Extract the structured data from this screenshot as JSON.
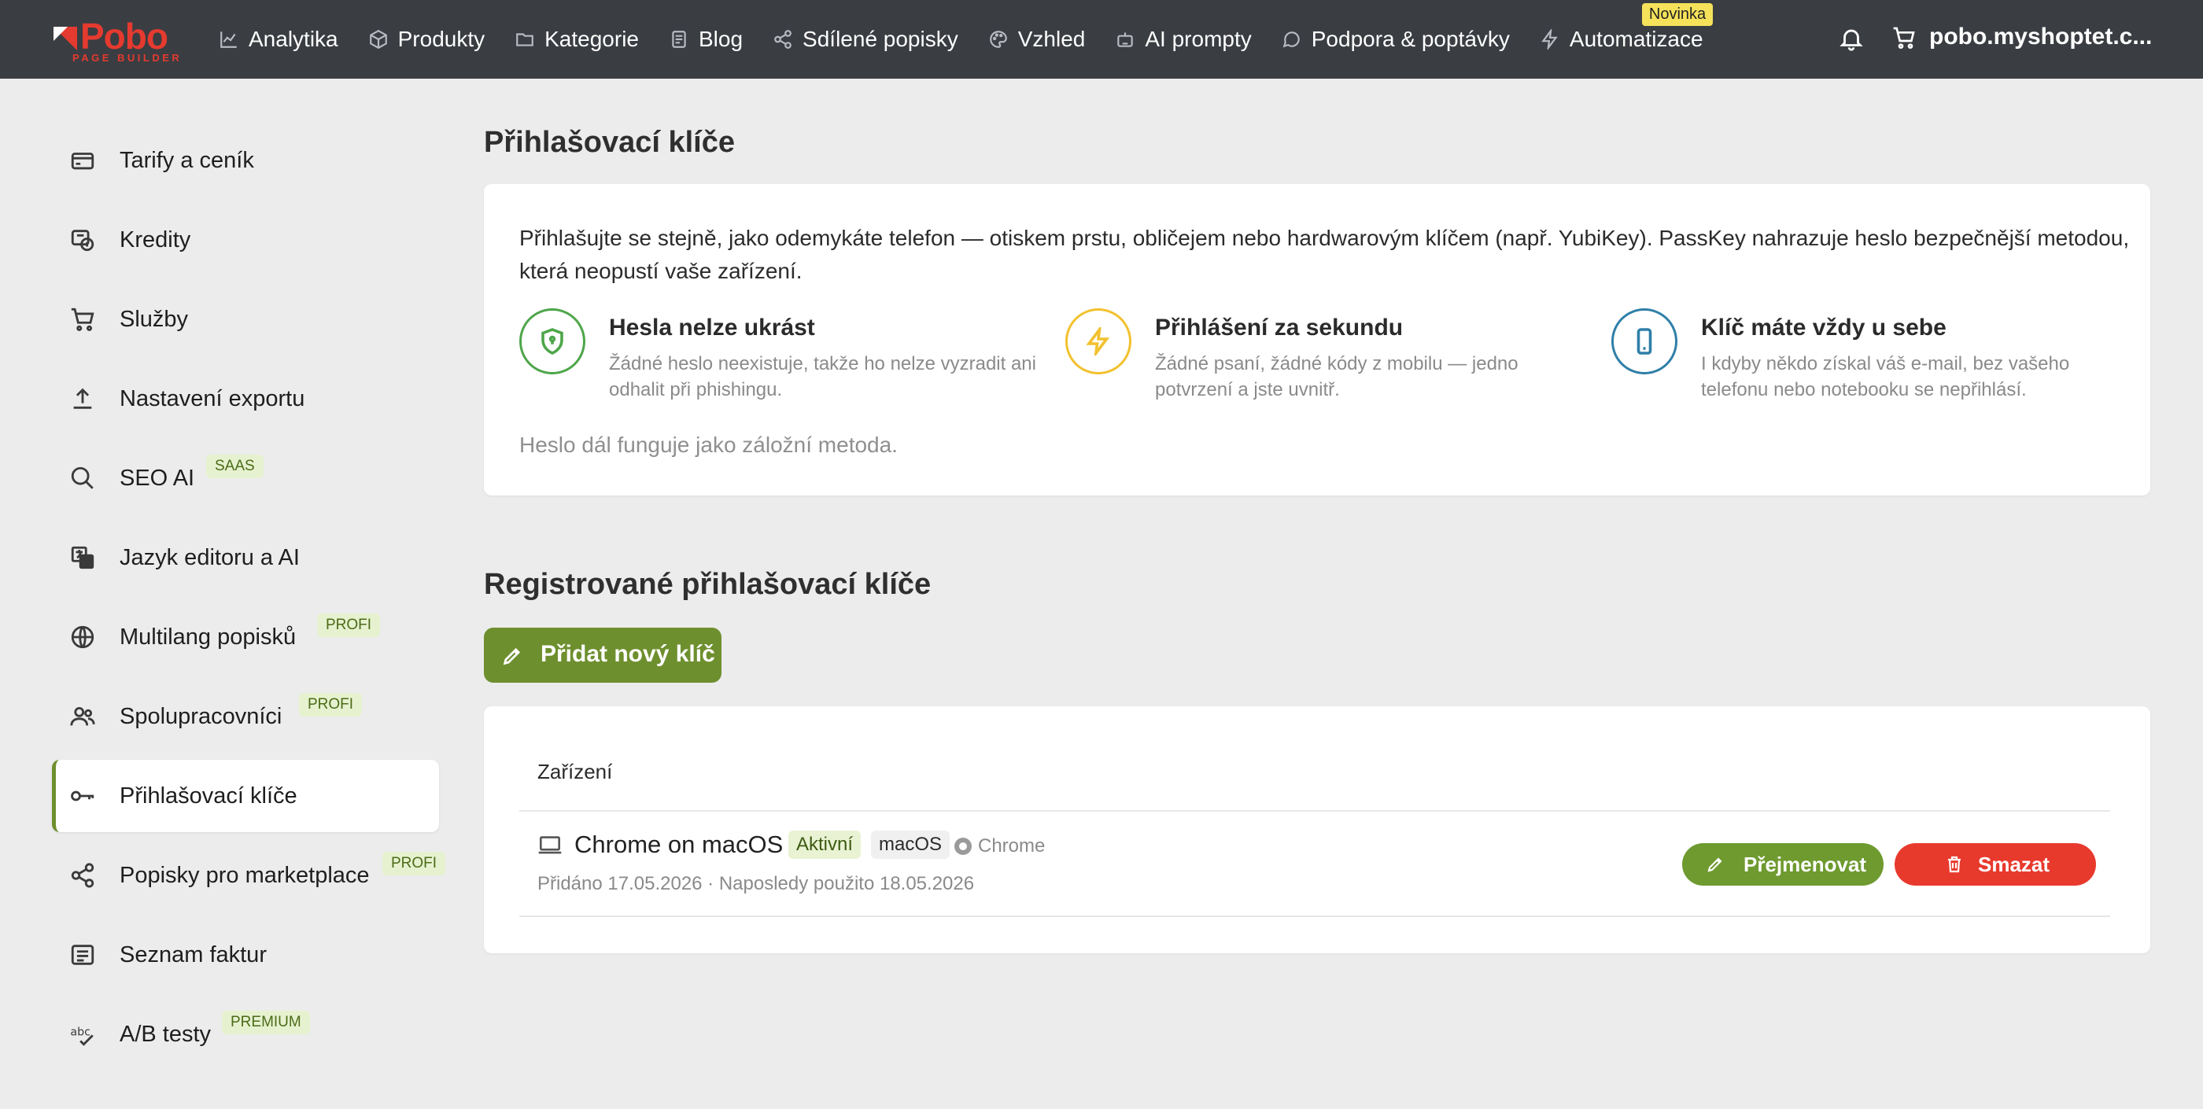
{
  "brand": {
    "name": "Pobo",
    "subtitle": "PAGE BUILDER",
    "color": "#e53a2f"
  },
  "nav": {
    "items": [
      {
        "label": "Analytika",
        "icon": "chart-line-icon"
      },
      {
        "label": "Produkty",
        "icon": "box-icon"
      },
      {
        "label": "Kategorie",
        "icon": "folder-icon"
      },
      {
        "label": "Blog",
        "icon": "document-icon"
      },
      {
        "label": "Sdílené popisky",
        "icon": "share-icon"
      },
      {
        "label": "Vzhled",
        "icon": "palette-icon"
      },
      {
        "label": "AI prompty",
        "icon": "robot-icon"
      },
      {
        "label": "Podpora & poptávky",
        "icon": "chat-bubble-icon"
      },
      {
        "label": "Automatizace",
        "icon": "bolt-icon"
      }
    ],
    "new_badge": "Novinka",
    "shop": "pobo.myshoptet.c..."
  },
  "sidebar": {
    "items": [
      {
        "label": "Tarify a ceník",
        "icon": "credit-card-icon"
      },
      {
        "label": "Kredity",
        "icon": "coins-icon"
      },
      {
        "label": "Služby",
        "icon": "cart-icon"
      },
      {
        "label": "Nastavení exportu",
        "icon": "upload-icon"
      },
      {
        "label": "SEO AI",
        "icon": "search-icon",
        "tag": "SAAS"
      },
      {
        "label": "Jazyk editoru a AI",
        "icon": "translate-icon"
      },
      {
        "label": "Multilang popisků",
        "icon": "globe-icon",
        "tag": "PROFI"
      },
      {
        "label": "Spolupracovníci",
        "icon": "users-icon",
        "tag": "PROFI"
      },
      {
        "label": "Přihlašovací klíče",
        "icon": "key-icon",
        "active": true
      },
      {
        "label": "Popisky pro marketplace",
        "icon": "share-icon",
        "tag": "PROFI"
      },
      {
        "label": "Seznam faktur",
        "icon": "list-icon"
      },
      {
        "label": "A/B testy",
        "icon": "abc-check-icon",
        "tag": "PREMIUM"
      }
    ]
  },
  "main": {
    "title": "Přihlašovací klíče",
    "intro": "Přihlašujte se stejně, jako odemykáte telefon — otiskem prstu, obličejem nebo hardwarovým klíčem (např. YubiKey). PassKey nahrazuje heslo bezpečnější metodou, která neopustí vaše zařízení.",
    "features": [
      {
        "title": "Hesla nelze ukrást",
        "desc": "Žádné heslo neexistuje, takže ho nelze vyzradit ani odhalit při phishingu.",
        "icon": "shield-icon",
        "color": "#4ea64a"
      },
      {
        "title": "Přihlášení za sekundu",
        "desc": "Žádné psaní, žádné kódy z mobilu — jedno potvrzení a jste uvnitř.",
        "icon": "bolt-icon",
        "color": "#f2c12e"
      },
      {
        "title": "Klíč máte vždy u sebe",
        "desc": "I kdyby někdo získal váš e-mail, bez vašeho telefonu nebo notebooku se nepřihlásí.",
        "icon": "phone-icon",
        "color": "#2f7fa8"
      }
    ],
    "fallback": "Heslo dál funguje jako záložní metoda.",
    "registered_title": "Registrované přihlašovací klíče",
    "add_button": "Přidat nový klíč",
    "table": {
      "header": "Zařízení",
      "rows": [
        {
          "device": "Chrome on macOS",
          "status": "Aktivní",
          "os": "macOS",
          "browser": "Chrome",
          "meta": "Přidáno 17.05.2026 · Naposledy použito 18.05.2026",
          "rename": "Přejmenovat",
          "delete": "Smazat"
        }
      ]
    }
  },
  "colors": {
    "accent": "#6e8f2e",
    "danger": "#e8392d",
    "topbar": "#3a3d42",
    "background": "#ececec"
  }
}
